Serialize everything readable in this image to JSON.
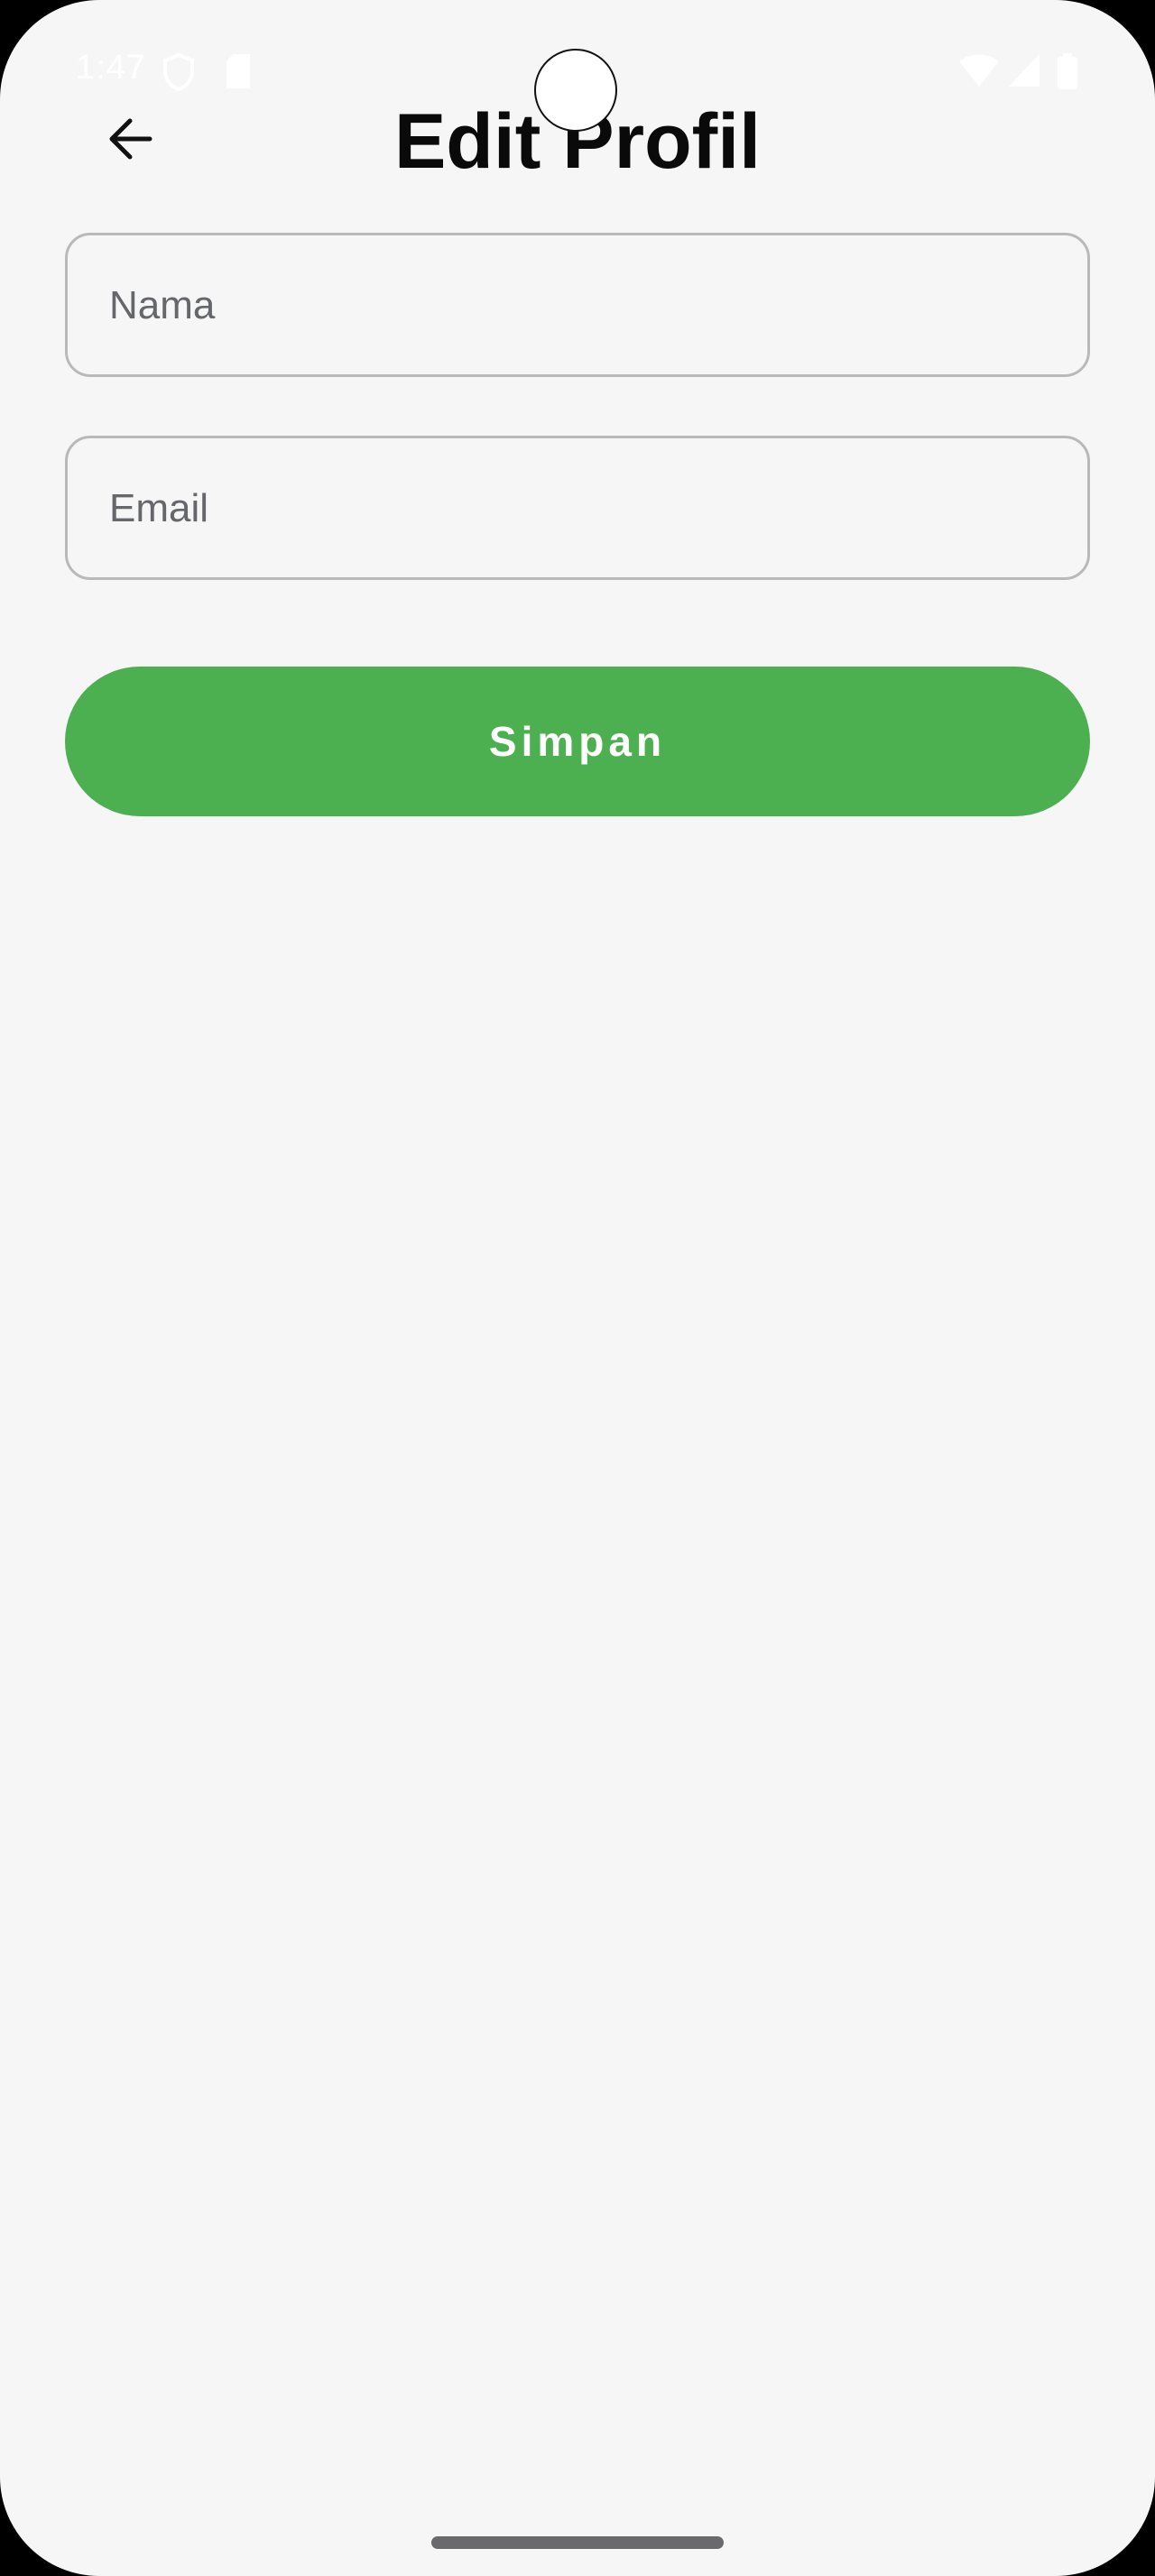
{
  "status_bar": {
    "time": "1:47",
    "icons": [
      "shield-icon",
      "sim-card-icon",
      "wifi-icon",
      "cellular-signal-icon",
      "battery-icon"
    ]
  },
  "header": {
    "title": "Edit Profil",
    "back_icon": "arrow-left-icon"
  },
  "form": {
    "name_field": {
      "placeholder": "Nama",
      "value": ""
    },
    "email_field": {
      "placeholder": "Email",
      "value": ""
    },
    "save_label": "Simpan"
  },
  "colors": {
    "background": "#f6f6f7",
    "accent": "#4caf50",
    "field_border": "#b9b9bc",
    "title": "#0a0a0a"
  }
}
